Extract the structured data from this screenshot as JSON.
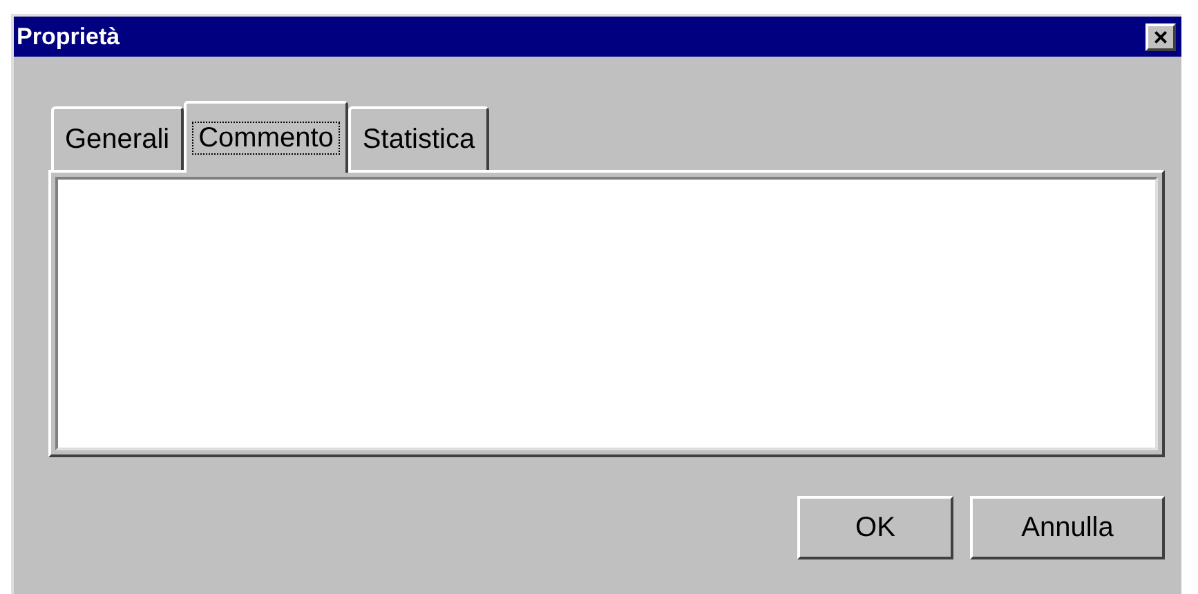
{
  "window": {
    "title": "Proprietà",
    "close_label": "×"
  },
  "tabs": [
    {
      "label": "Generali",
      "selected": false
    },
    {
      "label": "Commento",
      "selected": true
    },
    {
      "label": "Statistica",
      "selected": false
    }
  ],
  "buttons": [
    {
      "label": "OK"
    },
    {
      "label": "Annulla"
    }
  ]
}
